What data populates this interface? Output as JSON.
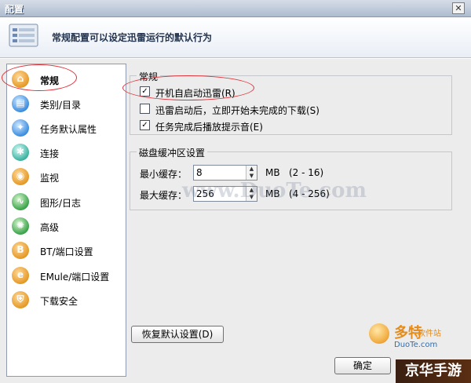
{
  "window": {
    "title": "配置",
    "close_glyph": "✕"
  },
  "header": {
    "text": "常规配置可以设定迅雷运行的默认行为"
  },
  "sidebar": {
    "items": [
      {
        "label": "常规",
        "icon": "general-icon",
        "glyph": "⌂",
        "color": "orange",
        "active": true
      },
      {
        "label": "类别/目录",
        "icon": "folder-icon",
        "glyph": "▤",
        "color": "blue"
      },
      {
        "label": "任务默认属性",
        "icon": "task-icon",
        "glyph": "✦",
        "color": "blue"
      },
      {
        "label": "连接",
        "icon": "connection-icon",
        "glyph": "✱",
        "color": "teal"
      },
      {
        "label": "监视",
        "icon": "monitor-icon",
        "glyph": "◉",
        "color": "orange"
      },
      {
        "label": "图形/日志",
        "icon": "graph-icon",
        "glyph": "∿",
        "color": "green"
      },
      {
        "label": "高级",
        "icon": "advanced-icon",
        "glyph": "✺",
        "color": "green"
      },
      {
        "label": "BT/端口设置",
        "icon": "bt-icon",
        "glyph": "B",
        "color": "orange"
      },
      {
        "label": "EMule/端口设置",
        "icon": "emule-icon",
        "glyph": "e",
        "color": "orange"
      },
      {
        "label": "下载安全",
        "icon": "security-icon",
        "glyph": "⛨",
        "color": "orange"
      }
    ]
  },
  "general_group": {
    "legend": "常规",
    "options": [
      {
        "label": "开机自启动迅雷(R)",
        "checked": true
      },
      {
        "label": "迅雷启动后，立即开始未完成的下载(S)",
        "checked": false
      },
      {
        "label": "任务完成后播放提示音(E)",
        "checked": true
      }
    ]
  },
  "cache_group": {
    "legend": "磁盘缓冲区设置",
    "min": {
      "label": "最小缓存：",
      "value": "8",
      "unit": "MB",
      "range": "(2 - 16)"
    },
    "max": {
      "label": "最大缓存：",
      "value": "256",
      "unit": "MB",
      "range": "(4 - 256)"
    }
  },
  "restore_button": "恢复默认设置(D)",
  "ok_button": "确定",
  "watermark": "www.DuoTe.com",
  "brand": {
    "name": "多特",
    "sub": "软件站",
    "url": "DuoTe.com"
  },
  "corner_badge": "京华手游",
  "colors": {
    "annotation": "#e0323a",
    "brand": "#e48b1a"
  }
}
